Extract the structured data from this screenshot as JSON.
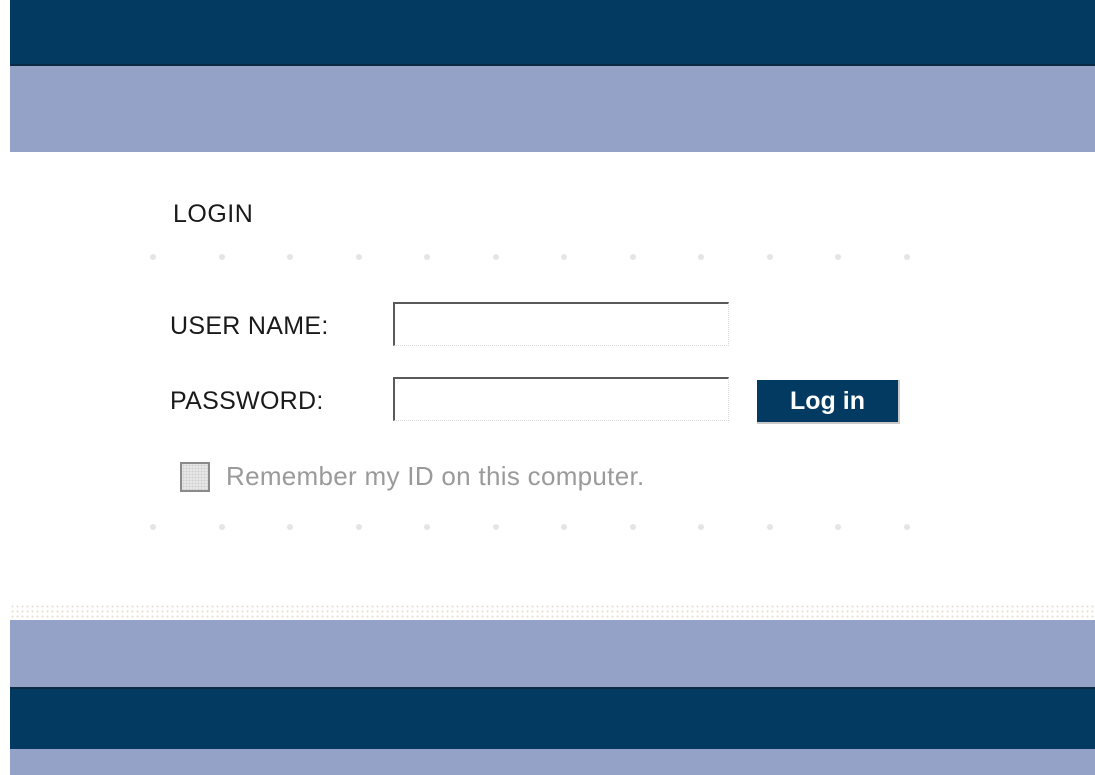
{
  "login": {
    "title": "LOGIN",
    "username_label": "USER NAME:",
    "password_label": "PASSWORD:",
    "username_value": "",
    "password_value": "",
    "submit_label": "Log in",
    "remember_label": "Remember my ID on this computer.",
    "remember_checked": false
  },
  "colors": {
    "dark_band": "#033a62",
    "light_band": "#95a2c8",
    "button_bg": "#033a62"
  }
}
